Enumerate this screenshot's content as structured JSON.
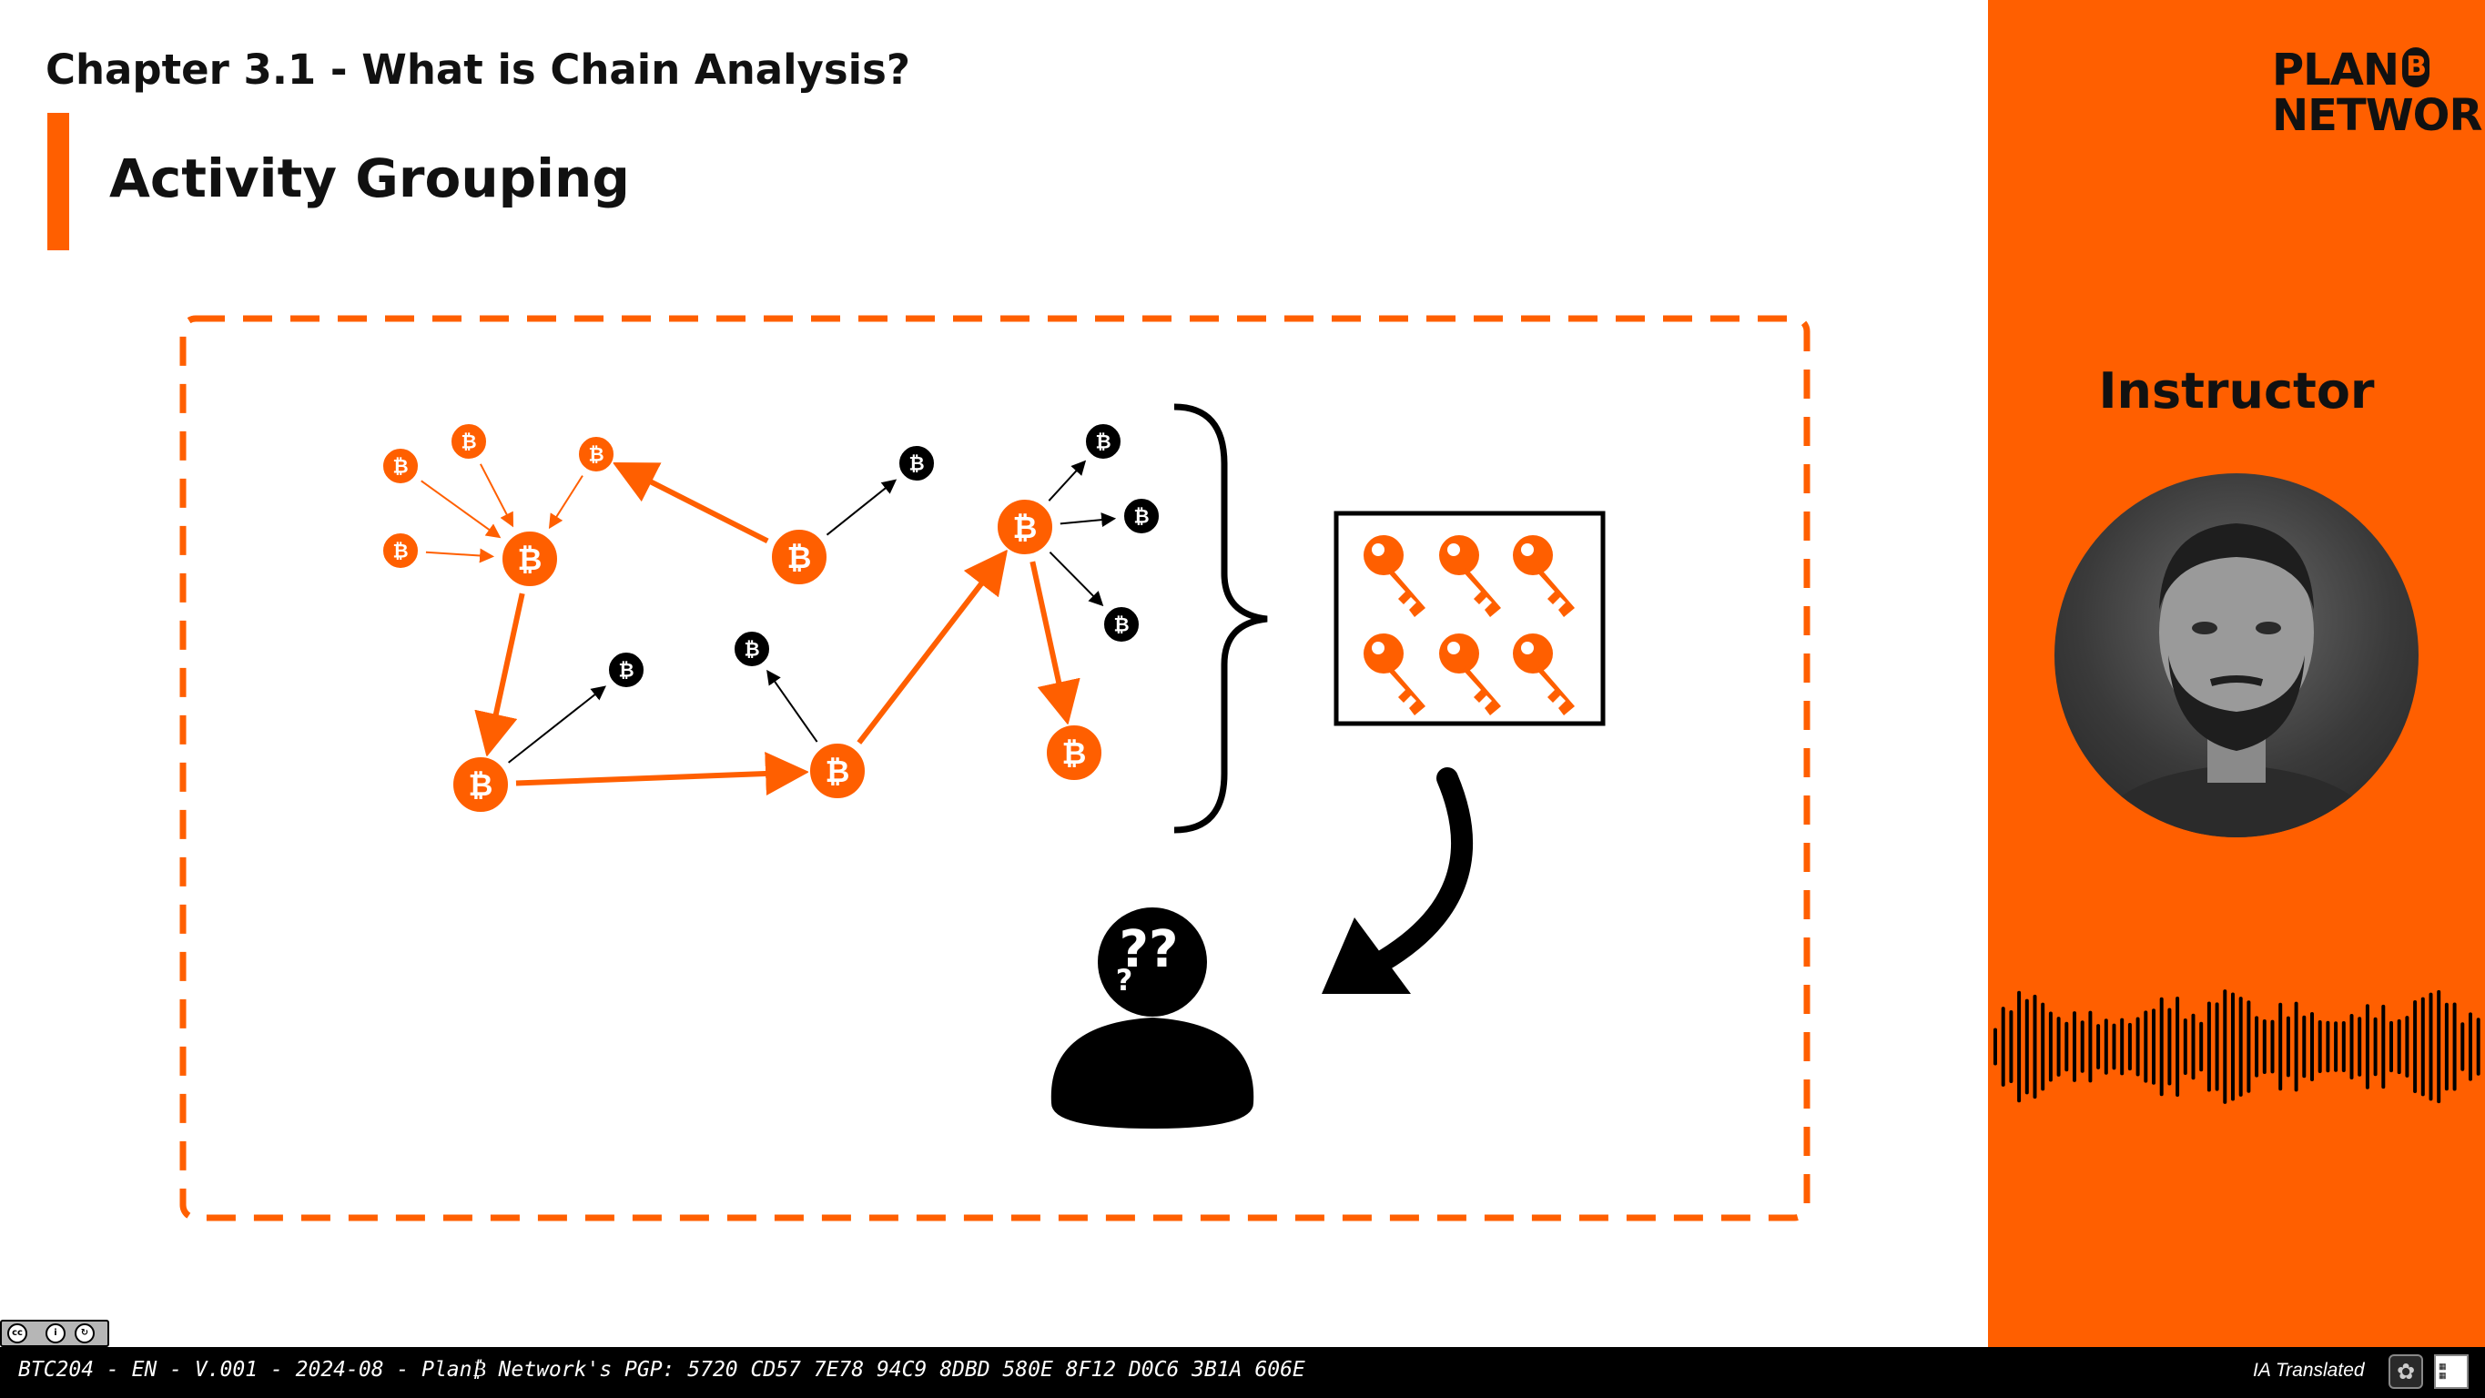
{
  "header": {
    "chapter_title": "Chapter 3.1 - What is Chain Analysis?",
    "section_title": "Activity Grouping"
  },
  "diagram": {
    "node_glyph": "₿",
    "question_marks": "??",
    "question_small": "?",
    "colors": {
      "accent": "#ff5f00",
      "dark": "#000000",
      "frame": "#ff5f00"
    },
    "icons": [
      "bitcoin-node-icon",
      "key-icon",
      "curly-brace-icon",
      "curved-arrow-icon",
      "confused-person-icon"
    ]
  },
  "sidebar": {
    "logo_line1": "PLAN",
    "logo_b": "B",
    "logo_line2": "NETWORK",
    "instructor_label": "Instructor",
    "background_color": "#ff5f00"
  },
  "footer": {
    "text": "BTC204 - EN - V.001 - 2024-08 - Plan₿ Network's PGP: 5720 CD57 7E78 94C9 8DBD 580E 8F12 D0C6 3B1A 606E",
    "ia_label": "IA Translated",
    "license_icons": [
      "cc-icon",
      "by-icon",
      "sa-icon"
    ]
  }
}
